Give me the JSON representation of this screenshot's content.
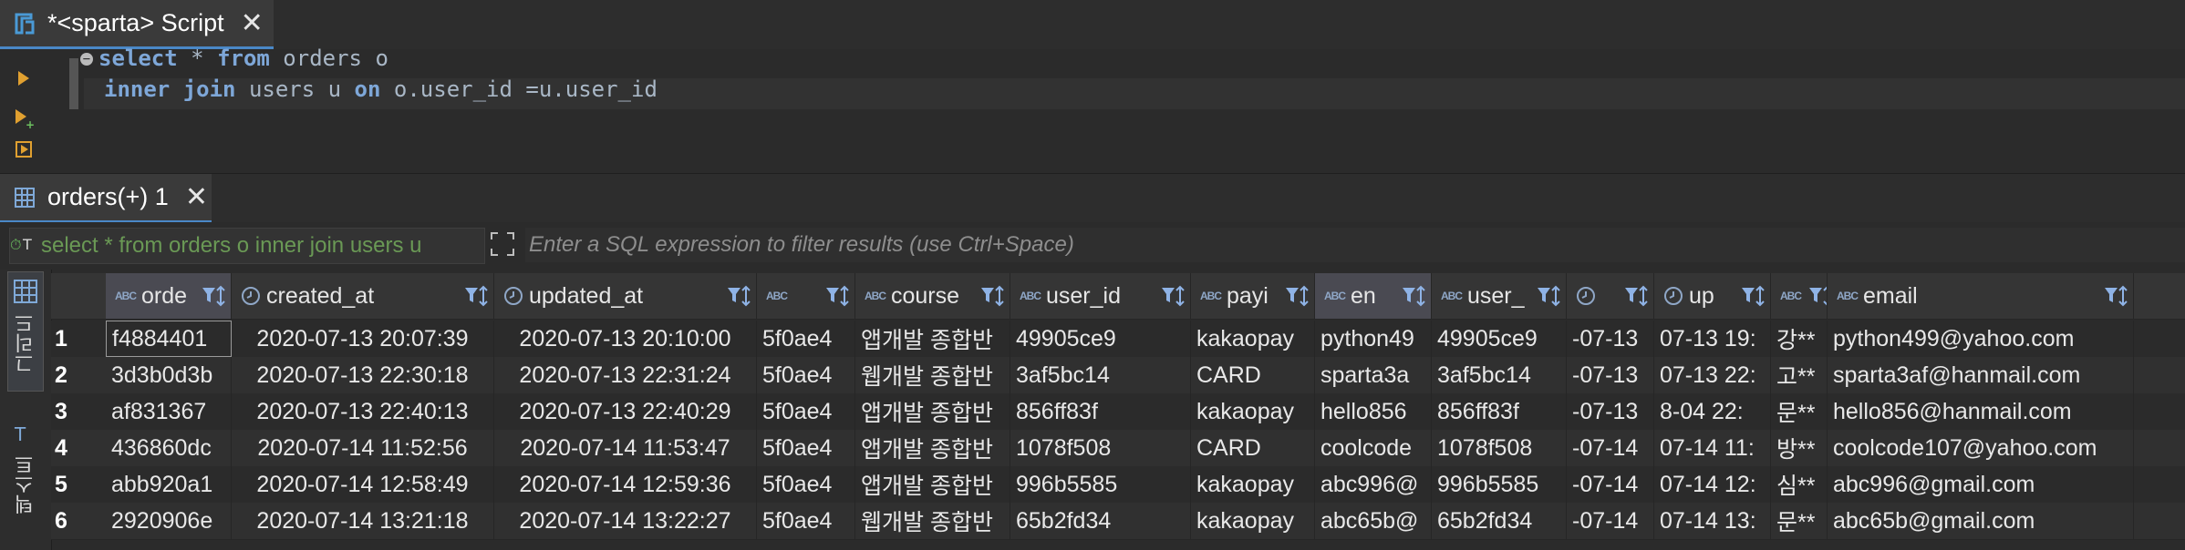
{
  "editor_tab": {
    "title": "*<sparta> Script"
  },
  "query": {
    "line1": {
      "kw1": "select",
      "mid": " * ",
      "kw2": "from",
      "rest": " orders o"
    },
    "line2": {
      "kw1": "inner join",
      "mid": " users u ",
      "kw2": "on",
      "rest": " o.user_id =u.user_id"
    }
  },
  "results_tab": {
    "title": "orders(+) 1"
  },
  "filter": {
    "query_text": "select * from orders o inner join users u",
    "placeholder": "Enter a SQL expression to filter results (use Ctrl+Space)"
  },
  "vtabs": {
    "grid": "그리드",
    "text": "텍스트"
  },
  "columns": [
    {
      "name": "orde",
      "type": "text"
    },
    {
      "name": "created_at",
      "type": "datetime"
    },
    {
      "name": "updated_at",
      "type": "datetime"
    },
    {
      "name": "",
      "type": "text"
    },
    {
      "name": "course",
      "type": "text"
    },
    {
      "name": "user_id",
      "type": "text"
    },
    {
      "name": "payi",
      "type": "text"
    },
    {
      "name": "en",
      "type": "text"
    },
    {
      "name": "user_",
      "type": "text"
    },
    {
      "name": "",
      "type": "datetime"
    },
    {
      "name": "up",
      "type": "datetime"
    },
    {
      "name": "",
      "type": "text"
    },
    {
      "name": "email",
      "type": "text"
    }
  ],
  "rows": [
    {
      "n": "1",
      "c": [
        "f4884401",
        "2020-07-13 20:07:39",
        "2020-07-13 20:10:00",
        "5f0ae4",
        "앱개발 종합반",
        "49905ce9",
        "kakaopay",
        "python49",
        "49905ce9",
        "-07-13",
        "07-13 19:",
        "강**",
        "python499@yahoo.com"
      ]
    },
    {
      "n": "2",
      "c": [
        "3d3b0d3b",
        "2020-07-13 22:30:18",
        "2020-07-13 22:31:24",
        "5f0ae4",
        "웹개발 종합반",
        "3af5bc14",
        "CARD",
        "sparta3a",
        "3af5bc14",
        "-07-13",
        "07-13 22:",
        "고**",
        "sparta3af@hanmail.com"
      ]
    },
    {
      "n": "3",
      "c": [
        "af831367",
        "2020-07-13 22:40:13",
        "2020-07-13 22:40:29",
        "5f0ae4",
        "앱개발 종합반",
        "856ff83f",
        "kakaopay",
        "hello856",
        "856ff83f",
        "-07-13",
        "8-04 22:",
        "문**",
        "hello856@hanmail.com"
      ]
    },
    {
      "n": "4",
      "c": [
        "436860dc",
        "2020-07-14 11:52:56",
        "2020-07-14 11:53:47",
        "5f0ae4",
        "앱개발 종합반",
        "1078f508",
        "CARD",
        "coolcode",
        "1078f508",
        "-07-14",
        "07-14 11:",
        "방**",
        "coolcode107@yahoo.com"
      ]
    },
    {
      "n": "5",
      "c": [
        "abb920a1",
        "2020-07-14 12:58:49",
        "2020-07-14 12:59:36",
        "5f0ae4",
        "앱개발 종합반",
        "996b5585",
        "kakaopay",
        "abc996@",
        "996b5585",
        "-07-14",
        "07-14 12:",
        "심**",
        "abc996@gmail.com"
      ]
    },
    {
      "n": "6",
      "c": [
        "2920906e",
        "2020-07-14 13:21:18",
        "2020-07-14 13:22:27",
        "5f0ae4",
        "웹개발 종합반",
        "65b2fd34",
        "kakaopay",
        "abc65b@",
        "65b2fd34",
        "-07-14",
        "07-14 13:",
        "문**",
        "abc65b@gmail.com"
      ]
    }
  ],
  "colors": {
    "accent": "#4a88c7",
    "keyword": "#7ea7d8",
    "filter_query": "#6a9955"
  }
}
